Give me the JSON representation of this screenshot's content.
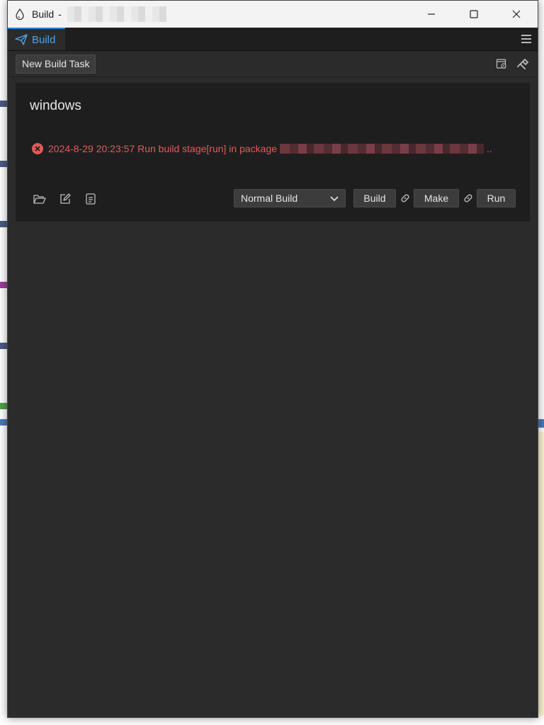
{
  "window": {
    "title": "Build",
    "controls": [
      "minimize-icon",
      "maximize-icon",
      "close-icon"
    ]
  },
  "tabs": [
    {
      "label": "Build",
      "icon": "paper-plane-icon",
      "active": true
    }
  ],
  "toolbar": {
    "new_task_label": "New Build Task",
    "right_icons": [
      "build-settings-icon",
      "tool-icon"
    ]
  },
  "task": {
    "platform": "windows",
    "log": {
      "status_icon": "error-icon",
      "message": "2024-8-29 20:23:57 Run build stage[run] in package",
      "suffix": ".."
    },
    "actions_left": [
      "open-folder-icon",
      "edit-icon",
      "document-icon"
    ],
    "build_mode": "Normal Build",
    "buttons": {
      "build": "Build",
      "make": "Make",
      "run": "Run"
    }
  },
  "colors": {
    "accent": "#4ea3e6",
    "error": "#e15b5b",
    "panel": "#1e1e1e",
    "background": "#2b2b2b"
  }
}
